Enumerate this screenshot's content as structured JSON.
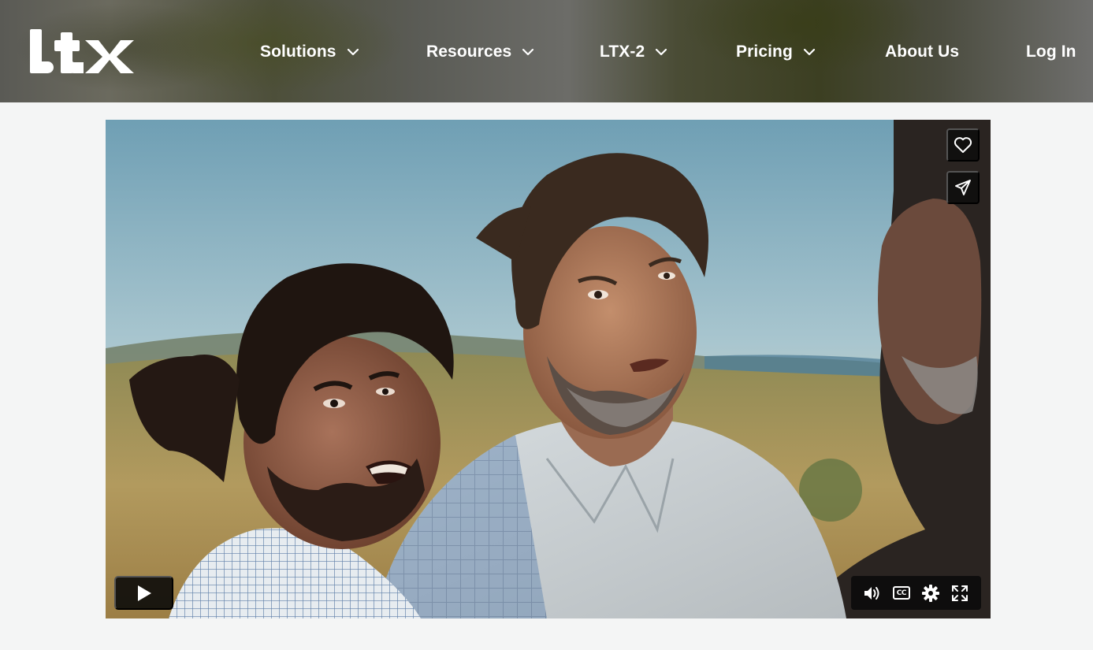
{
  "brand": {
    "logo_text": "LTX"
  },
  "nav": {
    "items": [
      {
        "label": "Solutions",
        "has_dropdown": true
      },
      {
        "label": "Resources",
        "has_dropdown": true
      },
      {
        "label": "LTX-2",
        "has_dropdown": true
      },
      {
        "label": "Pricing",
        "has_dropdown": true
      },
      {
        "label": "About Us",
        "has_dropdown": false
      },
      {
        "label": "Log In",
        "has_dropdown": false
      }
    ]
  },
  "video": {
    "side_actions": [
      {
        "name": "like",
        "icon": "heart-icon"
      },
      {
        "name": "share",
        "icon": "send-icon"
      }
    ],
    "controls": {
      "play_icon": "play-icon",
      "volume_icon": "volume-icon",
      "captions_label": "CC",
      "settings_icon": "gear-icon",
      "fullscreen_icon": "fullscreen-icon"
    }
  },
  "colors": {
    "page_background": "#f4f5f5",
    "nav_text": "#ffffff",
    "control_background": "#080808"
  }
}
